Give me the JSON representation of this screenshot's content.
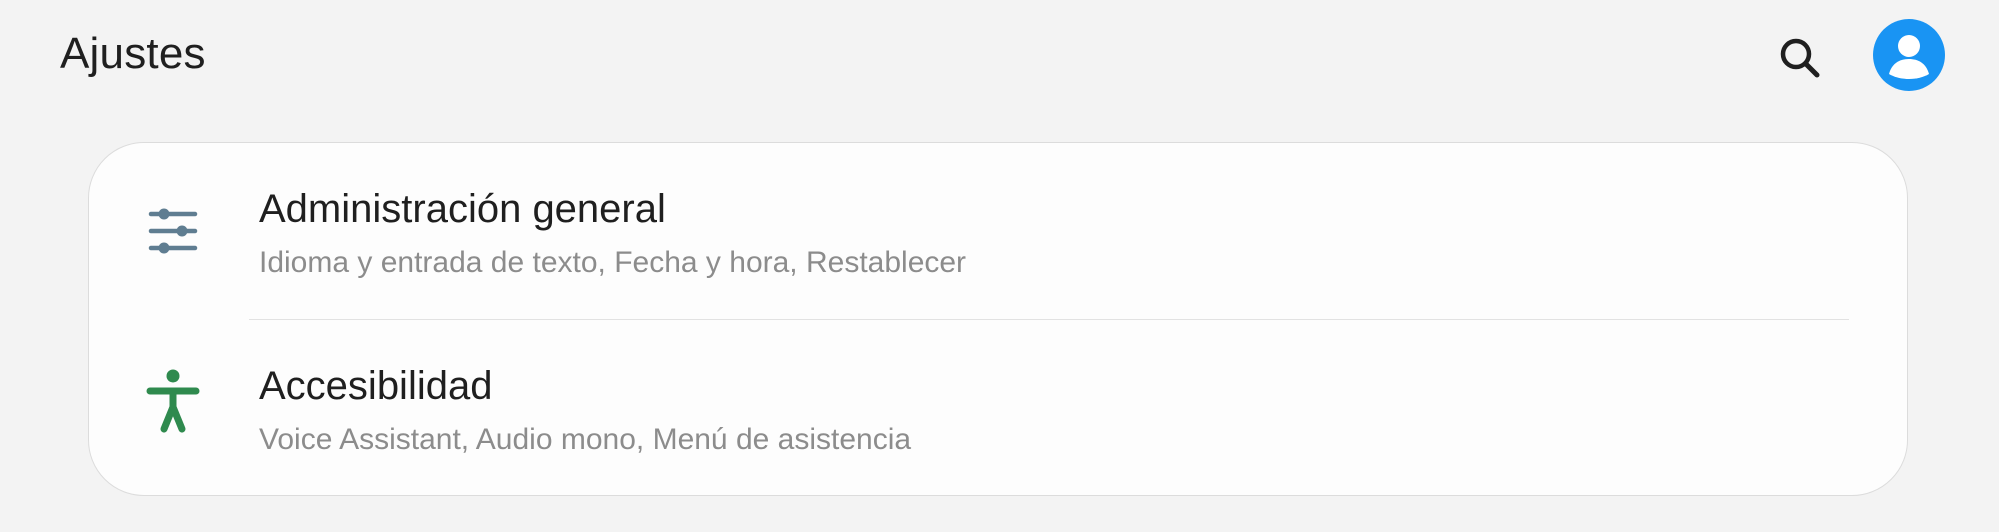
{
  "header": {
    "title": "Ajustes",
    "search_icon": "search-icon",
    "avatar_icon": "account-icon",
    "avatar_color": "#1994f3"
  },
  "settings": {
    "items": [
      {
        "title": "Administración general",
        "subtitle": "Idioma y entrada de texto, Fecha y hora, Restablecer",
        "icon": "sliders-icon",
        "icon_color": "#5f7d91"
      },
      {
        "title": "Accesibilidad",
        "subtitle": "Voice Assistant, Audio mono, Menú de asistencia",
        "icon": "accessibility-icon",
        "icon_color": "#2f8a4e"
      }
    ]
  }
}
